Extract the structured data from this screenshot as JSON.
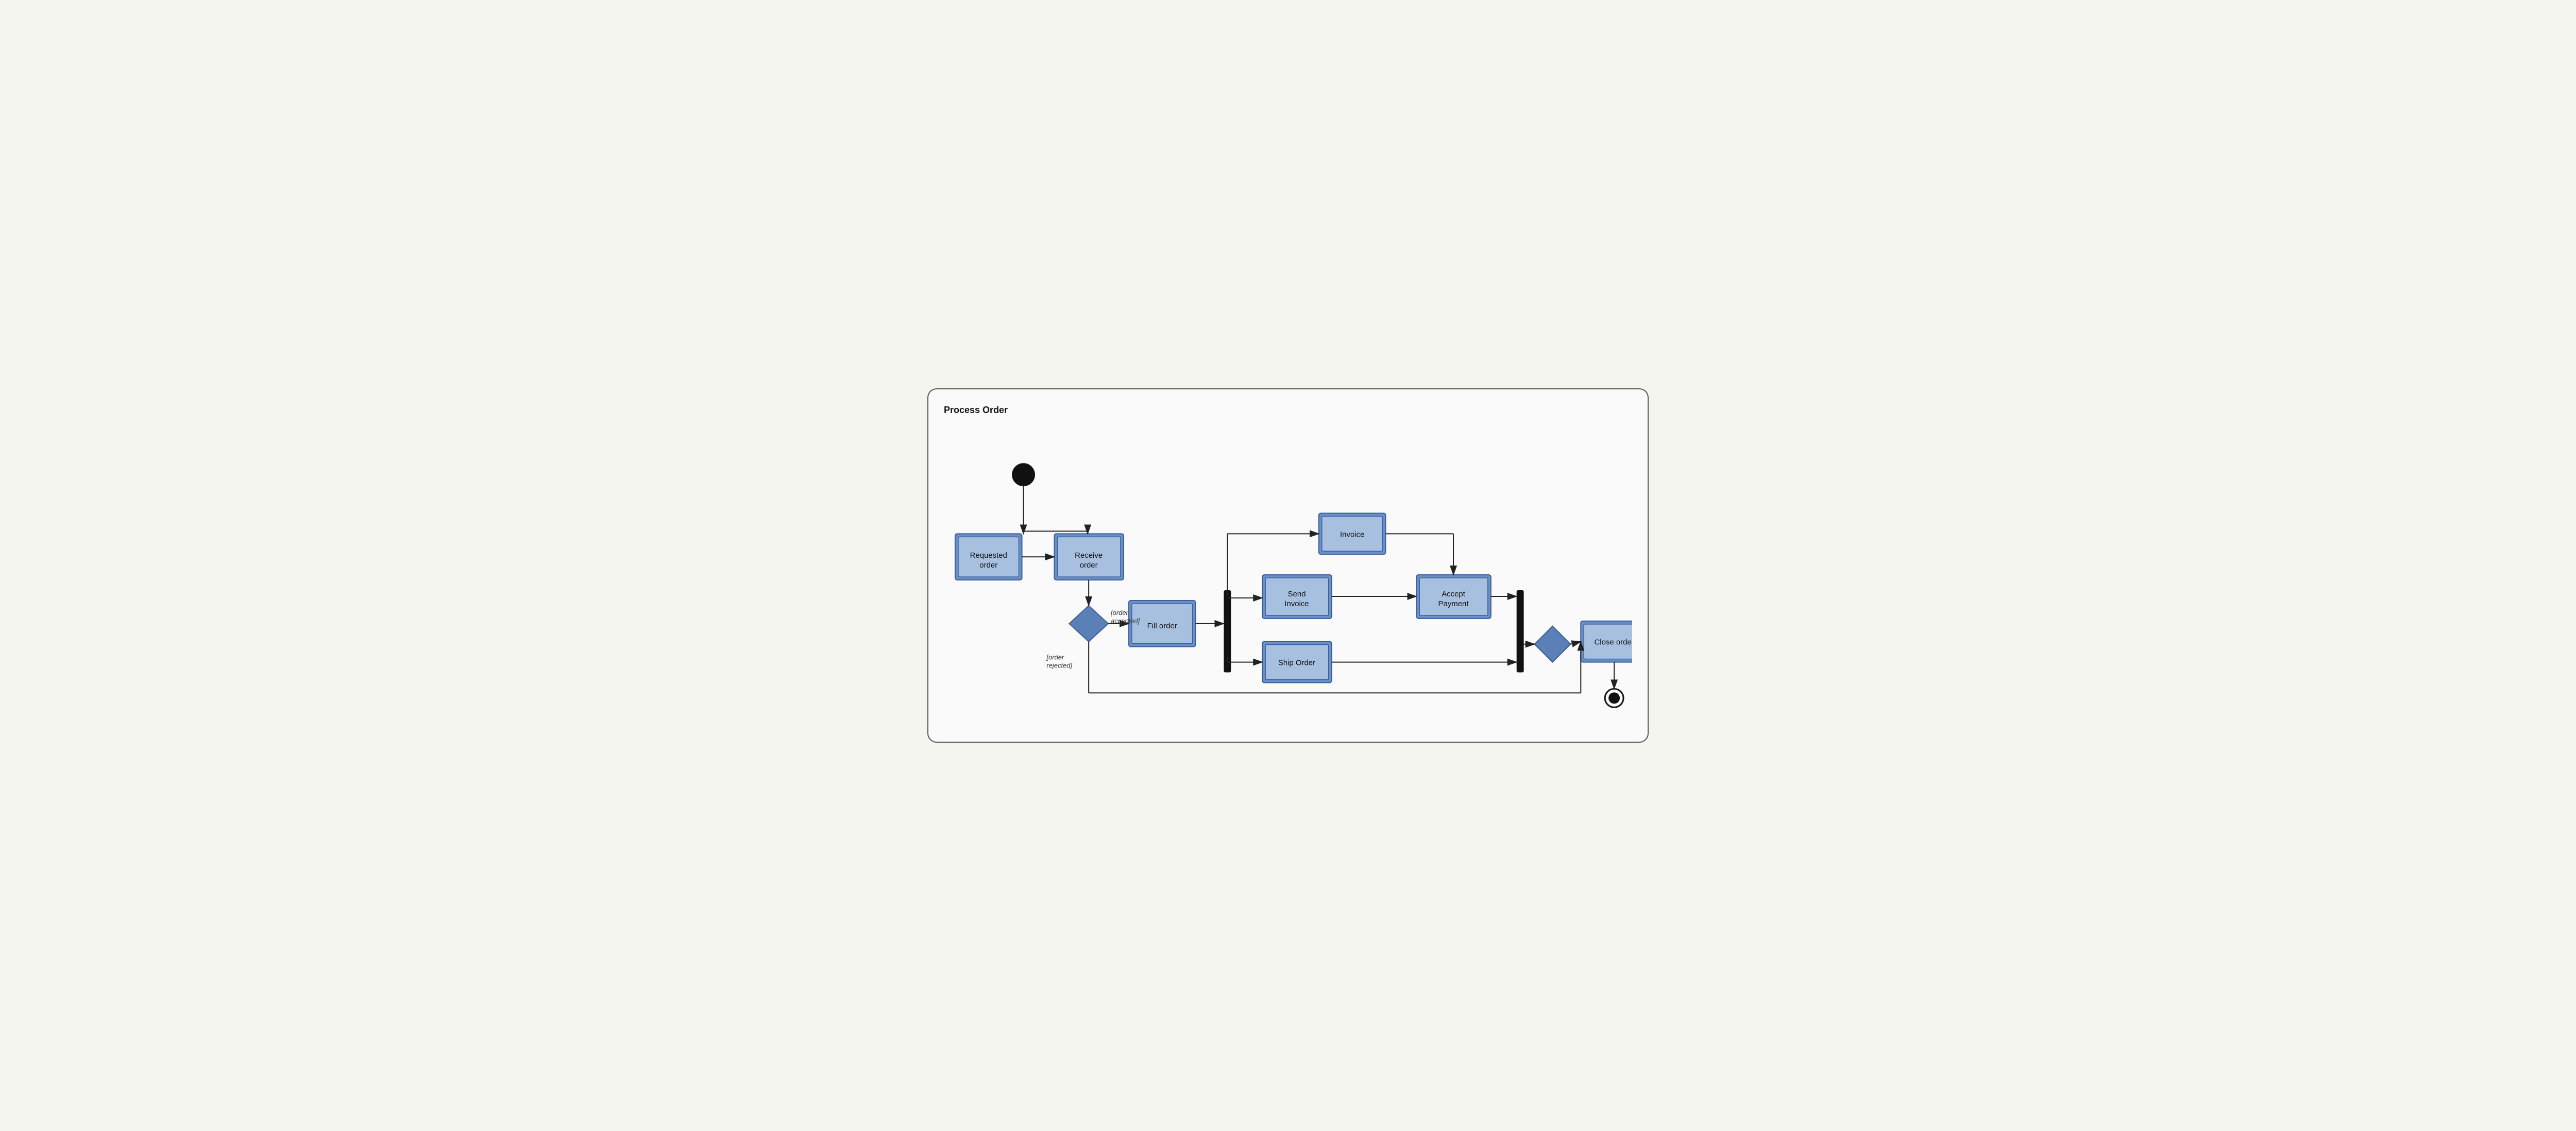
{
  "diagram": {
    "title": "Process Order",
    "nodes": {
      "requested_order": "Requested order",
      "receive_order": "Receive order",
      "fill_order": "Fill order",
      "invoice": "Invoice",
      "send_invoice": "Send Invoice",
      "accept_payment": "Accept Payment",
      "ship_order": "Ship Order",
      "close_order": "Close order"
    },
    "guards": {
      "accepted": "[order accepted]",
      "rejected": "[order rejected]"
    }
  }
}
